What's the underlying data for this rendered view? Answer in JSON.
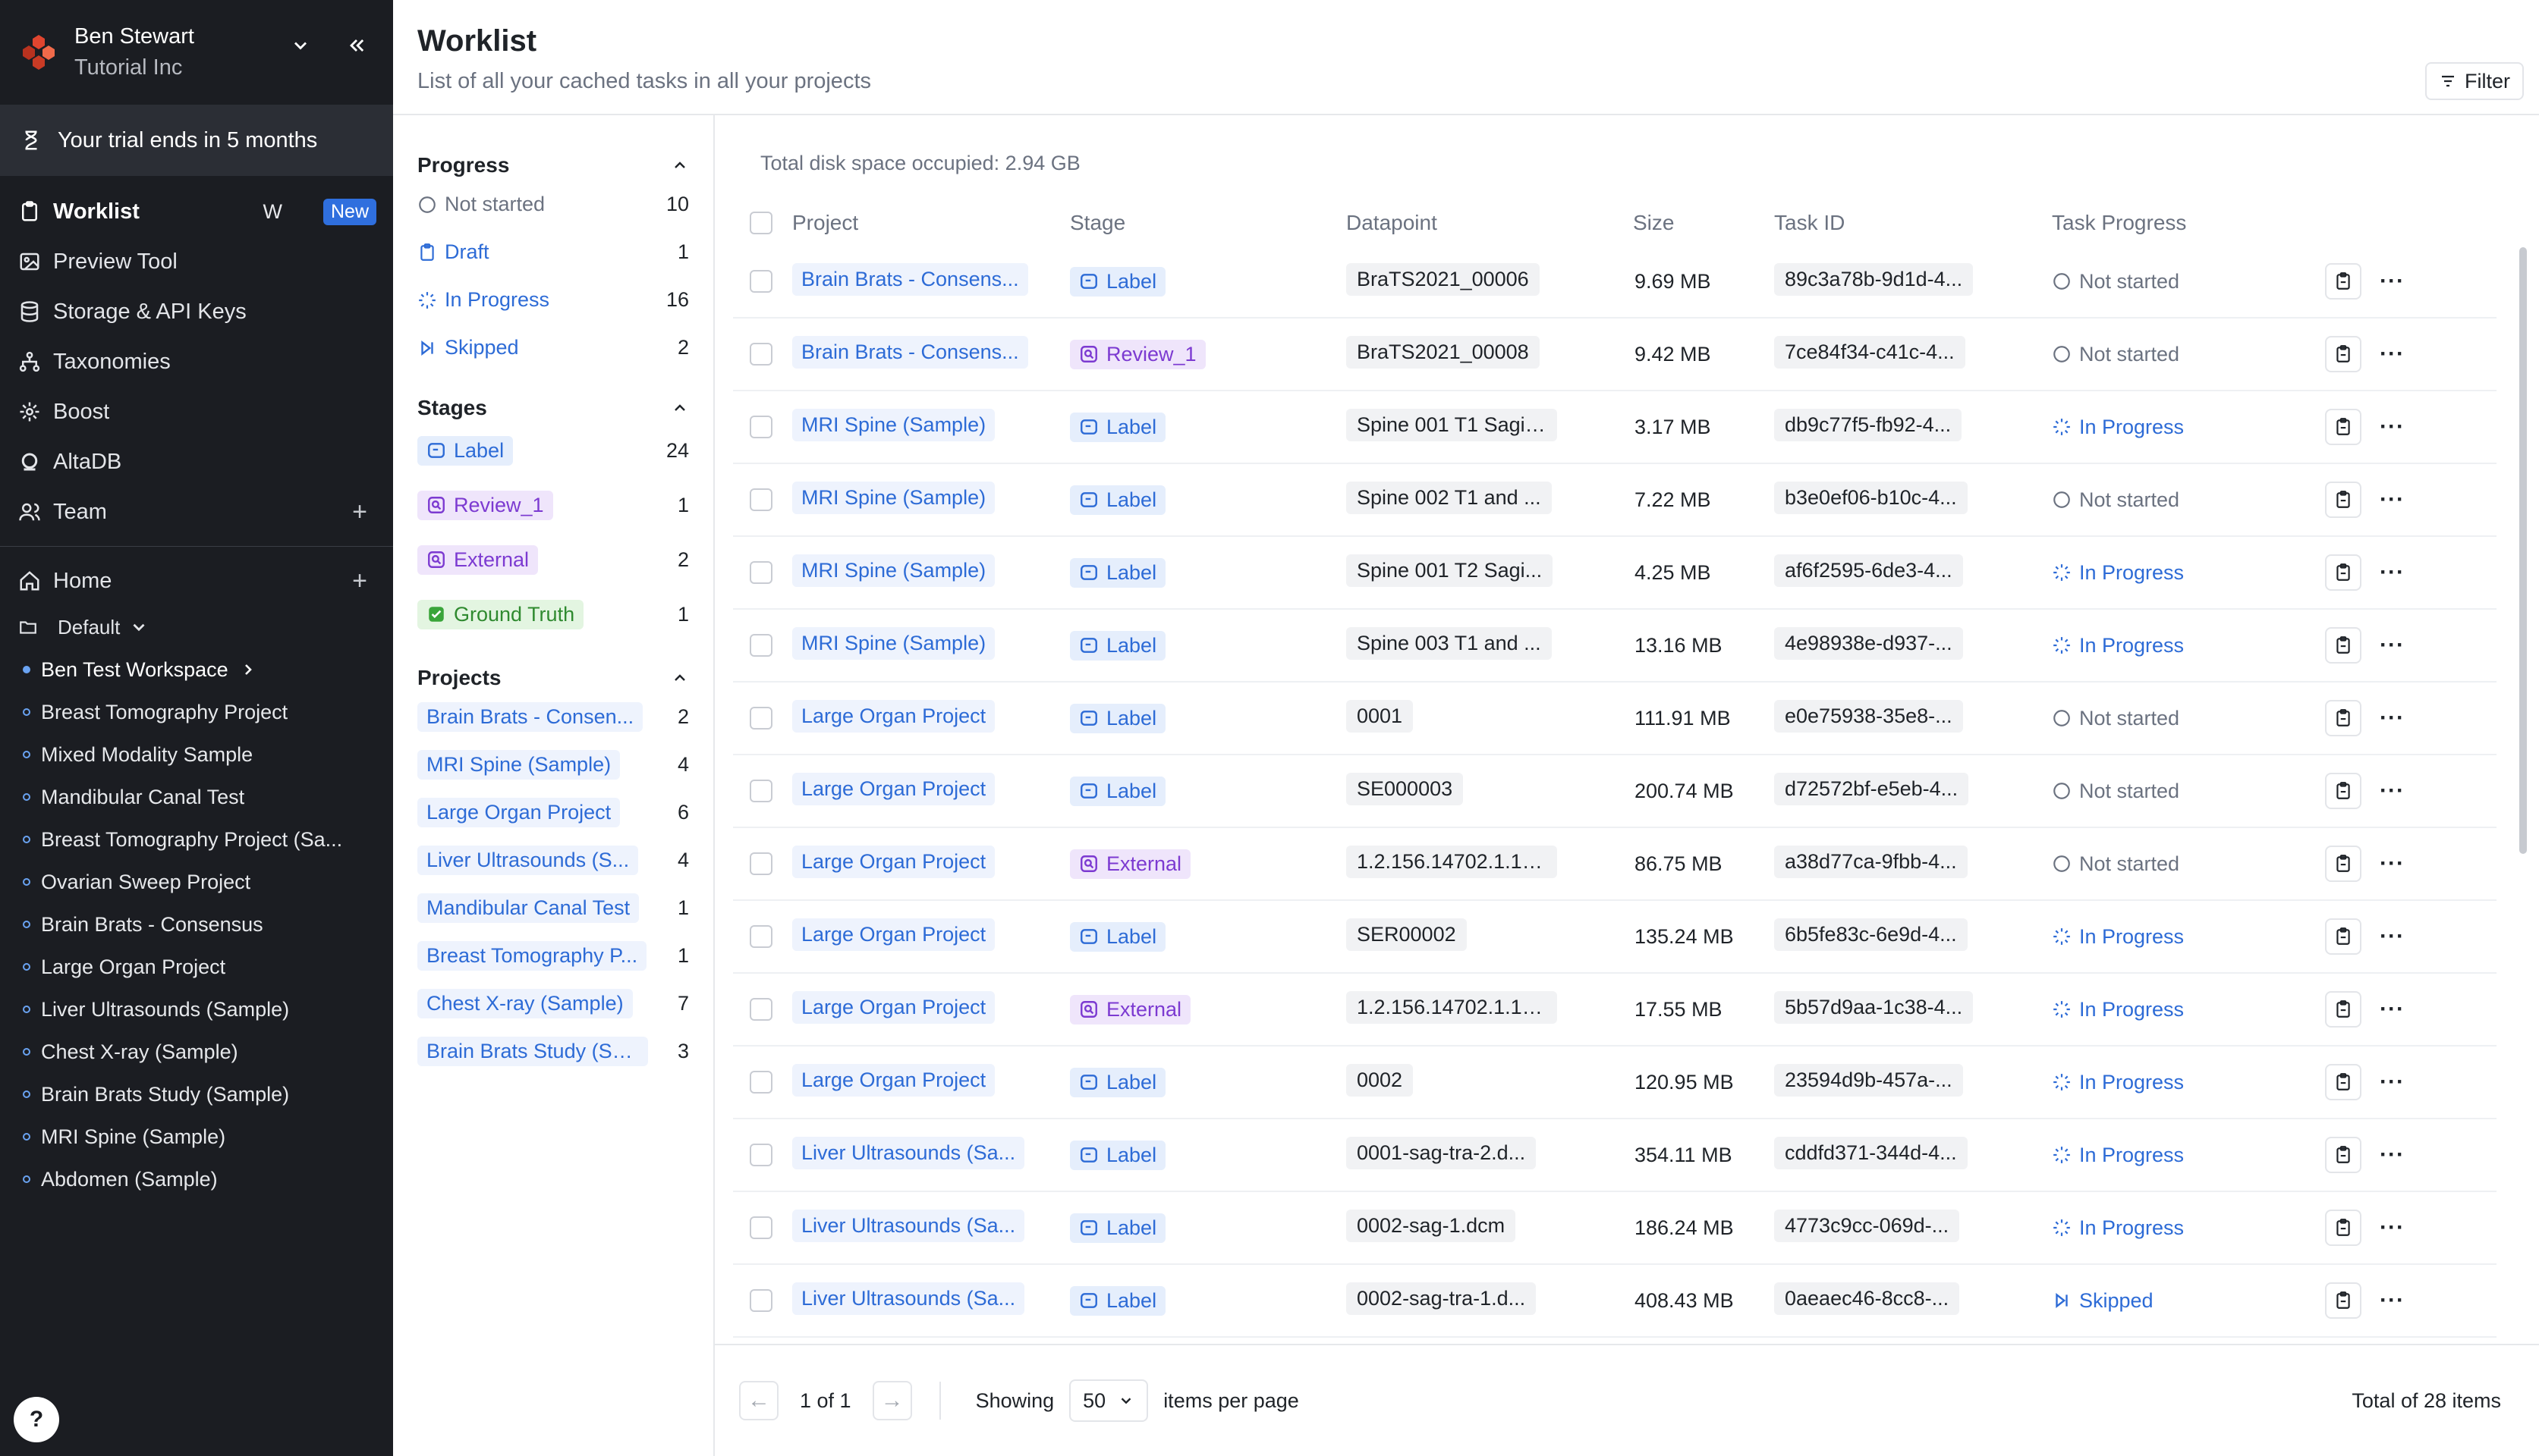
{
  "user": {
    "name": "Ben Stewart",
    "org": "Tutorial Inc"
  },
  "trial": "Your trial ends in 5 months",
  "nav": {
    "worklist": "Worklist",
    "worklist_kbd": "W",
    "worklist_badge": "New",
    "preview": "Preview Tool",
    "storage": "Storage & API Keys",
    "taxonomies": "Taxonomies",
    "boost": "Boost",
    "altadb": "AltaDB",
    "team": "Team",
    "home": "Home",
    "plus": "+"
  },
  "folder": "Default",
  "workspaces": [
    "Ben Test Workspace",
    "Breast Tomography Project",
    "Mixed Modality Sample",
    "Mandibular Canal Test",
    "Breast Tomography Project (Sa...",
    "Ovarian Sweep Project",
    "Brain Brats - Consensus",
    "Large Organ Project",
    "Liver Ultrasounds (Sample)",
    "Chest X-ray (Sample)",
    "Brain Brats Study (Sample)",
    "MRI Spine (Sample)",
    "Abdomen (Sample)"
  ],
  "help": "?",
  "header": {
    "title": "Worklist",
    "subtitle": "List of all your cached tasks in all your projects",
    "filter": "Filter"
  },
  "filters": {
    "progress_title": "Progress",
    "progress": [
      {
        "label": "Not started",
        "count": "10"
      },
      {
        "label": "Draft",
        "count": "1"
      },
      {
        "label": "In Progress",
        "count": "16"
      },
      {
        "label": "Skipped",
        "count": "2"
      }
    ],
    "stages_title": "Stages",
    "stages": [
      {
        "label": "Label",
        "count": "24"
      },
      {
        "label": "Review_1",
        "count": "1"
      },
      {
        "label": "External",
        "count": "2"
      },
      {
        "label": "Ground Truth",
        "count": "1"
      }
    ],
    "projects_title": "Projects",
    "projects": [
      {
        "label": "Brain Brats - Consen...",
        "count": "2"
      },
      {
        "label": "MRI Spine (Sample)",
        "count": "4"
      },
      {
        "label": "Large Organ Project",
        "count": "6"
      },
      {
        "label": "Liver Ultrasounds (S...",
        "count": "4"
      },
      {
        "label": "Mandibular Canal Test",
        "count": "1"
      },
      {
        "label": "Breast Tomography P...",
        "count": "1"
      },
      {
        "label": "Chest X-ray (Sample)",
        "count": "7"
      },
      {
        "label": "Brain Brats Study (Sa...",
        "count": "3"
      }
    ]
  },
  "table": {
    "disk": "Total disk space occupied: 2.94 GB",
    "headers": [
      "Project",
      "Stage",
      "Datapoint",
      "Size",
      "Task ID",
      "Task Progress"
    ],
    "rows": [
      {
        "project": "Brain Brats - Consens...",
        "stage": "Label",
        "datapoint": "BraTS2021_00006",
        "size": "9.69 MB",
        "task": "89c3a78b-9d1d-4...",
        "progress": "Not started"
      },
      {
        "project": "Brain Brats - Consens...",
        "stage": "Review_1",
        "datapoint": "BraTS2021_00008",
        "size": "9.42 MB",
        "task": "7ce84f34-c41c-4...",
        "progress": "Not started"
      },
      {
        "project": "MRI Spine (Sample)",
        "stage": "Label",
        "datapoint": "Spine 001 T1 Sagit...",
        "size": "3.17 MB",
        "task": "db9c77f5-fb92-4...",
        "progress": "In Progress"
      },
      {
        "project": "MRI Spine (Sample)",
        "stage": "Label",
        "datapoint": "Spine 002 T1 and ...",
        "size": "7.22 MB",
        "task": "b3e0ef06-b10c-4...",
        "progress": "Not started"
      },
      {
        "project": "MRI Spine (Sample)",
        "stage": "Label",
        "datapoint": "Spine 001 T2 Sagi...",
        "size": "4.25 MB",
        "task": "af6f2595-6de3-4...",
        "progress": "In Progress"
      },
      {
        "project": "MRI Spine (Sample)",
        "stage": "Label",
        "datapoint": "Spine 003 T1 and ...",
        "size": "13.16 MB",
        "task": "4e98938e-d937-...",
        "progress": "In Progress"
      },
      {
        "project": "Large Organ Project",
        "stage": "Label",
        "datapoint": "0001",
        "size": "111.91 MB",
        "task": "e0e75938-35e8-...",
        "progress": "Not started"
      },
      {
        "project": "Large Organ Project",
        "stage": "Label",
        "datapoint": "SE000003",
        "size": "200.74 MB",
        "task": "d72572bf-e5eb-4...",
        "progress": "Not started"
      },
      {
        "project": "Large Organ Project",
        "stage": "External",
        "datapoint": "1.2.156.14702.1.100...",
        "size": "86.75 MB",
        "task": "a38d77ca-9fbb-4...",
        "progress": "Not started"
      },
      {
        "project": "Large Organ Project",
        "stage": "Label",
        "datapoint": "SER00002",
        "size": "135.24 MB",
        "task": "6b5fe83c-6e9d-4...",
        "progress": "In Progress"
      },
      {
        "project": "Large Organ Project",
        "stage": "External",
        "datapoint": "1.2.156.14702.1.100...",
        "size": "17.55 MB",
        "task": "5b57d9aa-1c38-4...",
        "progress": "In Progress"
      },
      {
        "project": "Large Organ Project",
        "stage": "Label",
        "datapoint": "0002",
        "size": "120.95 MB",
        "task": "23594d9b-457a-...",
        "progress": "In Progress"
      },
      {
        "project": "Liver Ultrasounds (Sa...",
        "stage": "Label",
        "datapoint": "0001-sag-tra-2.d...",
        "size": "354.11 MB",
        "task": "cddfd371-344d-4...",
        "progress": "In Progress"
      },
      {
        "project": "Liver Ultrasounds (Sa...",
        "stage": "Label",
        "datapoint": "0002-sag-1.dcm",
        "size": "186.24 MB",
        "task": "4773c9cc-069d-...",
        "progress": "In Progress"
      },
      {
        "project": "Liver Ultrasounds (Sa...",
        "stage": "Label",
        "datapoint": "0002-sag-tra-1.d...",
        "size": "408.43 MB",
        "task": "0aeaec46-8cc8-...",
        "progress": "Skipped"
      }
    ]
  },
  "footer": {
    "prev": "←",
    "page": "1 of 1",
    "next": "→",
    "showing": "Showing",
    "per_page": "50",
    "items_per_page": "items per page",
    "total": "Total of 28 items"
  },
  "colors": {
    "sidebar_bg": "#1b1d22",
    "accent_blue": "#2d6bd6",
    "stage_purple": "#7c3ad1",
    "ground_truth_green": "#2f8a2f",
    "new_badge": "#2f6fde"
  }
}
